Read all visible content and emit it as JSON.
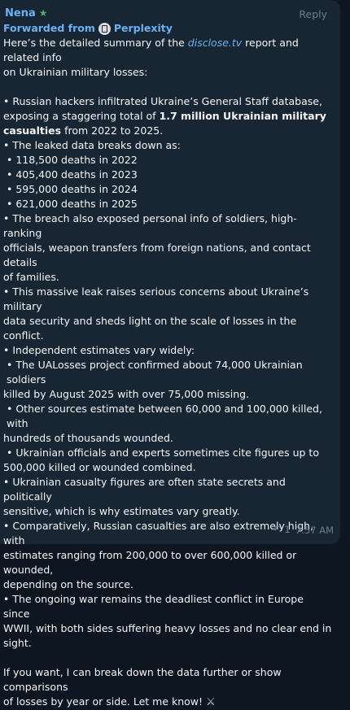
{
  "message": {
    "sender": "Nena",
    "reply_label": "Reply",
    "forwarded_prefix": "Forwarded from",
    "forwarded_source": "Perplexity",
    "intro_1": "Here’s the detailed summary of the ",
    "intro_link": "disclose.tv",
    "intro_2": " report and related info",
    "intro_3": "on Ukrainian military losses:",
    "p1a": "• Russian hackers infiltrated Ukraine’s General Staff database,",
    "p1b_pre": "exposing a staggering total of ",
    "p1b_bold": "1.7 million Ukrainian military",
    "p1c_bold": "casualties",
    "p1c_post": " from 2022 to 2025.",
    "p2": "• The leaked data breaks down as:",
    "d1": "• 118,500 deaths in 2022",
    "d2": "• 405,400 deaths in 2023",
    "d3": "• 595,000 deaths in 2024",
    "d4": "• 621,000 deaths in 2025",
    "p3a": "• The breach also exposed personal info of soldiers, high-ranking",
    "p3b": "officials, weapon transfers from foreign nations, and contact details",
    "p3c": "of families.",
    "p4a": "• This massive leak raises serious concerns about Ukraine’s military",
    "p4b": "data security and sheds light on the scale of losses in the conflict.",
    "p5": "• Independent estimates vary widely:",
    "p6a": "• The UALosses project confirmed about 74,000 Ukrainian soldiers",
    "p6b": "killed by August 2025 with over 75,000 missing.",
    "p7a": "• Other sources estimate between 60,000 and 100,000 killed, with",
    "p7b": "hundreds of thousands wounded.",
    "p8a": "• Ukrainian officials and experts sometimes cite figures up to",
    "p8b": "500,000 killed or wounded combined.",
    "p9a": "• Ukrainian casualty figures are often state secrets and politically",
    "p9b": "sensitive, which is why estimates vary greatly.",
    "p10a": "• Comparatively, Russian casualties are also extremely high, with",
    "p10b": "estimates ranging from 200,000 to over 600,000 killed or wounded,",
    "p10c": "depending on the source.",
    "p11a": "• The ongoing war remains the deadliest conflict in Europe since",
    "p11b": "WWII, with both sides suffering heavy losses and no clear end in",
    "p11c": "sight.",
    "p12a": "If you want, I can break down the data further or show comparisons",
    "p12b": "of losses by year or side. Let me know!",
    "reply_count": "1",
    "time": "7:57 AM"
  },
  "icons": {
    "star": "star-icon",
    "forward_source": "perplexity-logo-icon",
    "reply_arrow": "reply-arrow-icon",
    "swords": "crossed-swords-icon"
  },
  "colors": {
    "background": "#0e1621",
    "bubble": "#182533",
    "accent": "#6ab2f2",
    "star": "#4fae6a",
    "meta": "#6d7f8f"
  }
}
